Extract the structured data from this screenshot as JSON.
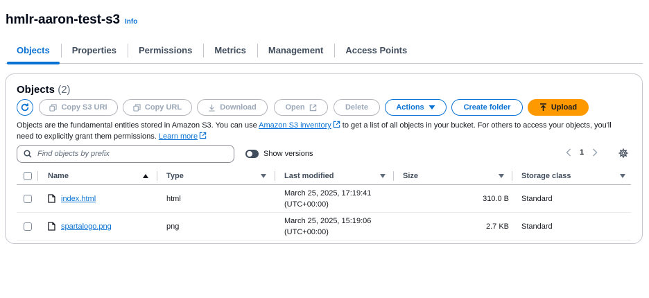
{
  "header": {
    "bucket_name": "hmlr-aaron-test-s3",
    "info_label": "Info"
  },
  "tabs": [
    {
      "label": "Objects",
      "active": true
    },
    {
      "label": "Properties",
      "active": false
    },
    {
      "label": "Permissions",
      "active": false
    },
    {
      "label": "Metrics",
      "active": false
    },
    {
      "label": "Management",
      "active": false
    },
    {
      "label": "Access Points",
      "active": false
    }
  ],
  "objects_panel": {
    "title": "Objects",
    "count": "(2)",
    "toolbar": {
      "copy_s3_uri": "Copy S3 URI",
      "copy_url": "Copy URL",
      "download": "Download",
      "open": "Open",
      "delete": "Delete",
      "actions": "Actions",
      "create_folder": "Create folder",
      "upload": "Upload"
    },
    "description": {
      "part1": "Objects are the fundamental entities stored in Amazon S3. You can use ",
      "inventory_link": "Amazon S3 inventory",
      "part2": " to get a list of all objects in your bucket. For others to access your objects, you'll need to explicitly grant them permissions. ",
      "learn_more": "Learn more"
    },
    "search": {
      "placeholder": "Find objects by prefix"
    },
    "show_versions_label": "Show versions",
    "pagination": {
      "current_page": "1"
    },
    "table": {
      "columns": {
        "name": "Name",
        "type": "Type",
        "last_modified": "Last modified",
        "size": "Size",
        "storage_class": "Storage class"
      },
      "rows": [
        {
          "name": "index.html",
          "type": "html",
          "modified_line1": "March 25, 2025, 17:19:41",
          "modified_line2": "(UTC+00:00)",
          "size": "310.0 B",
          "storage_class": "Standard"
        },
        {
          "name": "spartalogo.png",
          "type": "png",
          "modified_line1": "March 25, 2025, 15:19:06",
          "modified_line2": "(UTC+00:00)",
          "size": "2.7 KB",
          "storage_class": "Standard"
        }
      ]
    }
  },
  "colors": {
    "accent": "#0972d3",
    "upload_button": "#ff9900",
    "disabled_text": "#9ba7b6",
    "border": "#c6c6cd"
  }
}
